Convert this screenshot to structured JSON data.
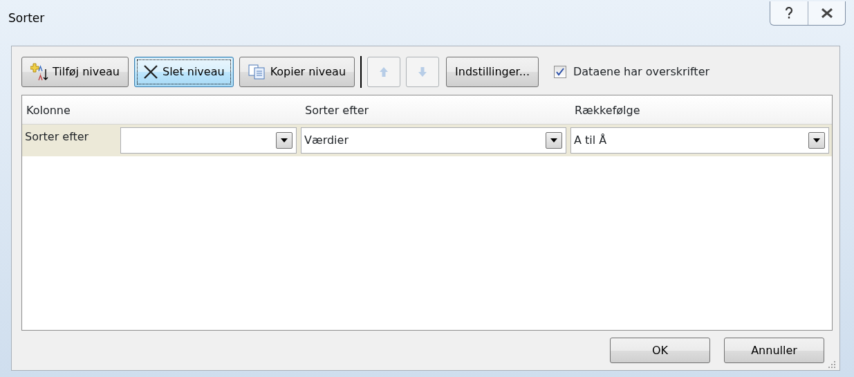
{
  "window": {
    "title": "Sorter"
  },
  "title_buttons": [
    {
      "kind": "help"
    },
    {
      "kind": "close"
    }
  ],
  "toolbar": [
    {
      "kind": "button",
      "label": "Tilføj niveau",
      "focused": false,
      "disabled": false
    },
    {
      "kind": "button",
      "label": "Slet niveau",
      "focused": true,
      "disabled": false
    },
    {
      "kind": "button",
      "label": "Kopier niveau",
      "focused": false,
      "disabled": false
    },
    {
      "kind": "separator"
    },
    {
      "kind": "icon-button",
      "focused": false,
      "disabled": true
    },
    {
      "kind": "icon-button",
      "focused": false,
      "disabled": true
    },
    {
      "kind": "button",
      "label": "Indstillinger...",
      "focused": false,
      "disabled": false
    },
    {
      "kind": "checkbox",
      "label": "Dataene har overskrifter",
      "checked": true
    }
  ],
  "table": {
    "columns": [
      "Kolonne",
      "Sorter efter",
      "Rækkefølge"
    ],
    "rows": [
      {
        "label": "Sorter efter",
        "column": "",
        "sort_on": "Værdier",
        "order": "A til Å"
      }
    ]
  },
  "buttons": [
    "OK",
    "Annuller"
  ]
}
